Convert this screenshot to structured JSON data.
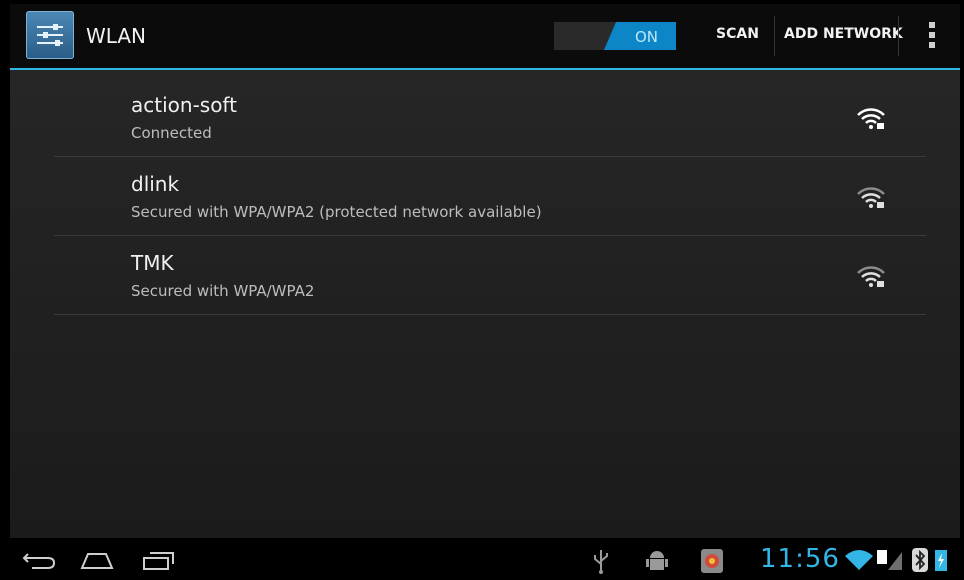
{
  "actionbar": {
    "title": "WLAN",
    "toggle_label": "ON",
    "scan_label": "SCAN",
    "add_network_label": "ADD NETWORK",
    "icon": "settings-sliders-icon",
    "overflow_icon": "overflow-menu-icon"
  },
  "networks": [
    {
      "name": "action-soft",
      "status": "Connected",
      "icon": "wifi-locked-icon"
    },
    {
      "name": "dlink",
      "status": "Secured with WPA/WPA2 (protected network available)",
      "icon": "wifi-locked-icon"
    },
    {
      "name": "TMK",
      "status": "Secured with WPA/WPA2",
      "icon": "wifi-locked-icon"
    }
  ],
  "statusbar": {
    "time": "11:56",
    "icons": [
      "usb-icon",
      "android-debug-icon",
      "app-notification-icon",
      "wifi-icon",
      "signal-icon",
      "bluetooth-icon",
      "battery-icon"
    ]
  },
  "navbar": {
    "icons": [
      "back-icon",
      "home-icon",
      "recent-apps-icon"
    ]
  },
  "colors": {
    "accent": "#33b5e5",
    "toggle_on": "#0d86c8",
    "background": "#1f1f1f"
  }
}
